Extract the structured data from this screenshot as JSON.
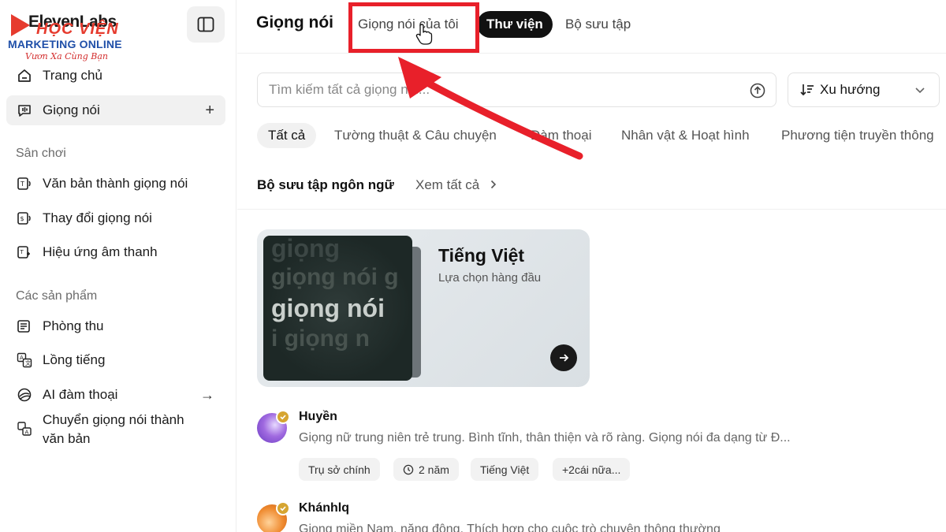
{
  "colors": {
    "accent": "#111111",
    "highlight_red": "#e8202a",
    "badge_gold": "#d6a531",
    "brand_red": "#e63b2e",
    "brand_blue": "#1f4fa8"
  },
  "watermark": {
    "brand": "ElevenLabs",
    "hoc": "HỌC VIỆN",
    "marketing": "MARKETING ONLINE",
    "slogan": "Vươn Xa Cùng Bạn"
  },
  "sidebar": {
    "toggle_icon": "sidebar-toggle-icon",
    "items_top": [
      {
        "label": "Trang chủ",
        "icon": "home-icon"
      },
      {
        "label": "Giọng nói",
        "icon": "voice-icon",
        "action": "+"
      }
    ],
    "sections": [
      {
        "label": "Sân chơi",
        "items": [
          {
            "label": "Văn bản thành giọng nói",
            "icon": "text-to-speech-icon"
          },
          {
            "label": "Thay đổi giọng nói",
            "icon": "voice-changer-icon"
          },
          {
            "label": "Hiệu ứng âm thanh",
            "icon": "sound-effects-icon"
          }
        ]
      },
      {
        "label": "Các sản phẩm",
        "items": [
          {
            "label": "Phòng thu",
            "icon": "studio-icon"
          },
          {
            "label": "Lồng tiếng",
            "icon": "dubbing-icon"
          },
          {
            "label": "AI đàm thoại",
            "icon": "conversational-ai-icon",
            "action": "→"
          },
          {
            "label": "Chuyển giọng nói thành văn bản",
            "icon": "speech-to-text-icon"
          }
        ]
      }
    ]
  },
  "header": {
    "title": "Giọng nói",
    "tabs": [
      {
        "label": "Giọng nói của tôi",
        "active": false
      },
      {
        "label": "Thư viện",
        "active": true
      },
      {
        "label": "Bộ sưu tập",
        "active": false
      }
    ]
  },
  "search": {
    "placeholder": "Tìm kiếm tất cả giọng nói...",
    "sort_label": "Xu hướng"
  },
  "filters": [
    "Tất cả",
    "Tường thuật & Câu chuyện",
    "Đàm thoại",
    "Nhân vật & Hoạt hình",
    "Phương tiện truyền thông"
  ],
  "collection": {
    "title": "Bộ sưu tập ngôn ngữ",
    "see_all": "Xem tất cả",
    "card": {
      "title": "Tiếng Việt",
      "subtitle": "Lựa chọn hàng đầu",
      "art_text": [
        "giọng",
        "giọng nói g",
        "giọng nói",
        "i giọng n"
      ]
    }
  },
  "voices": [
    {
      "name": "Huyền",
      "description": "Giọng nữ trung niên trẻ trung. Bình tĩnh, thân thiện và rõ ràng. Giọng nói đa dạng từ Đ...",
      "tags": [
        "Trụ sở chính",
        "2 năm",
        "Tiếng Việt",
        "+2cái nữa..."
      ]
    },
    {
      "name": "Khánhlq",
      "description": "Giọng miền Nam, năng động. Thích hợp cho cuộc trò chuyện thông thường"
    }
  ]
}
